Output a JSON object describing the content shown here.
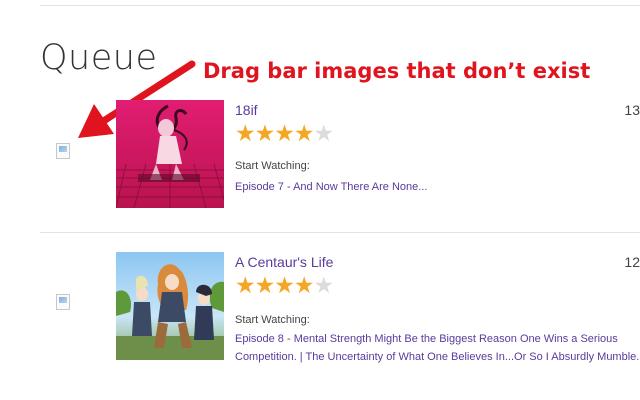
{
  "page": {
    "title": "Queue"
  },
  "annotation": {
    "text": "Drag bar images that don’t exist"
  },
  "queue": {
    "items": [
      {
        "title": "18if",
        "count": "13",
        "rating": 4,
        "rating_max": 5,
        "start_label": "Start Watching:",
        "episode": "Episode 7 - And Now There Are None..."
      },
      {
        "title": "A Centaur's Life",
        "count": "12",
        "rating": 4,
        "rating_max": 5,
        "start_label": "Start Watching:",
        "episode": "Episode 8 - Mental Strength Might Be the Biggest Reason One Wins a Serious Competition. | The Uncertainty of What One Believes In...Or So I Absurdly Mumble."
      }
    ]
  },
  "colors": {
    "accent": "#5b3a9c",
    "annotation": "#e0141e",
    "star_on": "#f5a623",
    "star_off": "#dcdcdc"
  },
  "icons": {
    "drag": "broken-image-icon",
    "star": "star-icon"
  }
}
